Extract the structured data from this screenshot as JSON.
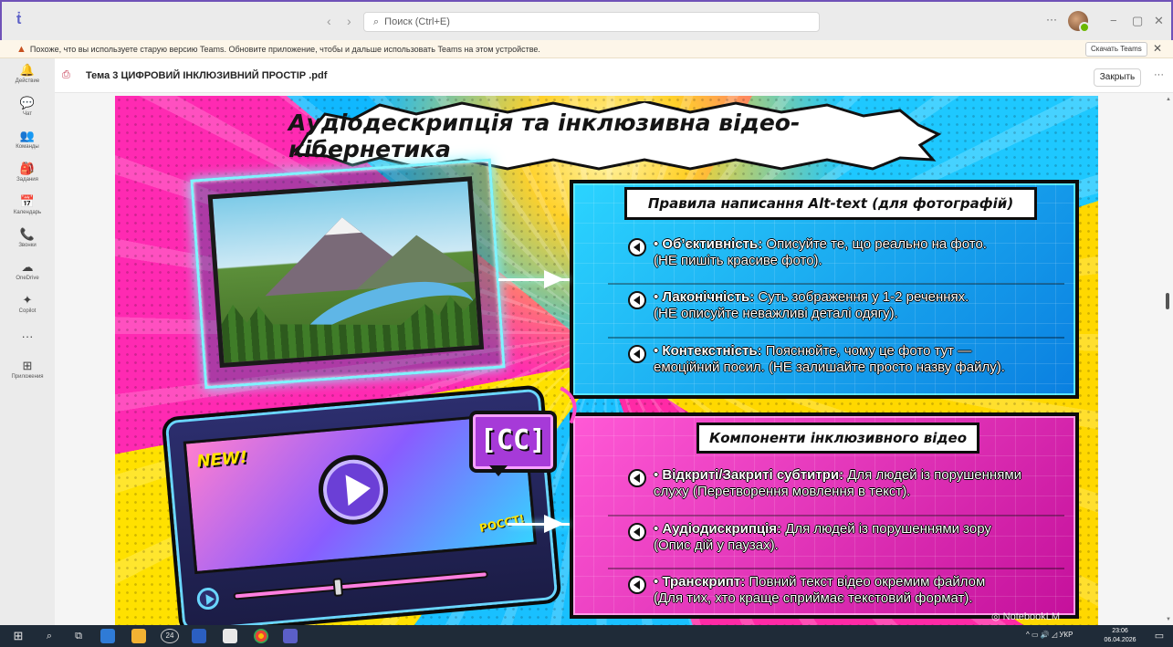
{
  "app": {
    "title_bar": {
      "back": "‹",
      "forward": "›",
      "search_placeholder": "Поиск (Ctrl+E)",
      "more": "···",
      "minimize": "−",
      "restore": "▢",
      "close": "✕"
    },
    "banner": {
      "text": "Похоже, что вы используете старую версию Teams. Обновите приложение, чтобы и дальше использовать Teams на этом устройстве.",
      "download_label": "Скачать Teams",
      "close": "✕"
    },
    "rail": [
      {
        "icon": "bell-icon",
        "glyph": "🔔",
        "label": "Действие"
      },
      {
        "icon": "chat-icon",
        "glyph": "💬",
        "label": "Чат"
      },
      {
        "icon": "teams-icon",
        "glyph": "👥",
        "label": "Команды"
      },
      {
        "icon": "assignments-icon",
        "glyph": "🎒",
        "label": "Задания"
      },
      {
        "icon": "calendar-icon",
        "glyph": "📅",
        "label": "Календарь"
      },
      {
        "icon": "calls-icon",
        "glyph": "📞",
        "label": "Звонки"
      },
      {
        "icon": "onedrive-icon",
        "glyph": "☁",
        "label": "OneDrive"
      },
      {
        "icon": "copilot-icon",
        "glyph": "✦",
        "label": "Copilot"
      },
      {
        "icon": "more-icon",
        "glyph": "···",
        "label": ""
      },
      {
        "icon": "apps-icon",
        "glyph": "⊞",
        "label": "Приложения"
      }
    ]
  },
  "document": {
    "title": "Тема 3 ЦИФРОВИЙ ІНКЛЮЗИВНИЙ ПРОСТІР .pdf",
    "close_label": "Закрыть",
    "more": "···"
  },
  "slide": {
    "headline": "Аудіодескрипція та інклюзивна відео-кібернетика",
    "alt_text_panel": {
      "title": "Правила написання Alt-text (для фотографій)",
      "items": [
        {
          "term": "Об’єктивність:",
          "line1": " Описуйте те, що реально на фото.",
          "line2": "(НЕ пишіть красиве фото)."
        },
        {
          "term": "Лаконічність:",
          "line1": " Суть зображення у 1-2 реченнях.",
          "line2": "(НЕ описуйте неважливі деталі одягу)."
        },
        {
          "term": "Контекстність:",
          "line1": " Пояснюйте, чому це фото тут —",
          "line2": "емоційний посил. (НЕ залишайте просто назву файлу)."
        }
      ]
    },
    "video_panel": {
      "title": "Компоненти інклюзивного відео",
      "items": [
        {
          "term": "Відкриті/Закриті субтитри:",
          "line1": " Для людей із порушеннями",
          "line2": "слуху (Перетворення мовлення в текст)."
        },
        {
          "term": "Аудіодискрипція:",
          "line1": " Для людей із порушеннями зору",
          "line2": "(Опис дій у паузах)."
        },
        {
          "term": "Транскрипт:",
          "line1": " Повний текст відео окремим файлом",
          "line2": "(Для тих, хто краще сприймає текстовий формат)."
        }
      ]
    },
    "cc_badge": "[CC]",
    "new_tag": "NEW!",
    "pow_tag": "POCCT!",
    "watermark": "NotebookLM"
  },
  "taskbar": {
    "tray_lang": "УКР",
    "time": "23:06",
    "date": "06.04.2026",
    "badge_count": "24"
  },
  "colors": {
    "teams_purple": "#5b5fc7",
    "banner_bg": "#fdf6e9",
    "panel_blue": "#19c0ff",
    "panel_pink": "#ff2ab2",
    "taskbar": "#1f2b38"
  }
}
